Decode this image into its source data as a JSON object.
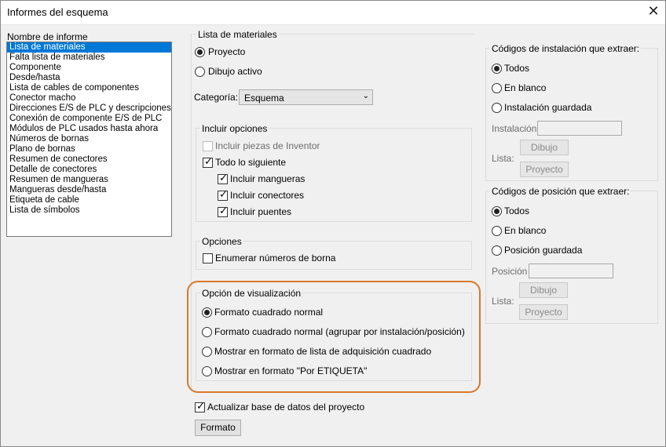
{
  "window": {
    "title": "Informes del esquema",
    "close_icon": "close-icon"
  },
  "report_list": {
    "label": "Nombre de informe",
    "items": [
      "Lista de materiales",
      "Falta lista de materiales",
      "Componente",
      "Desde/hasta",
      "Lista de cables de componentes",
      "Conector macho",
      "Direcciones E/S de PLC y descripciones",
      "Conexión de componente E/S de PLC",
      "Módulos de PLC usados hasta ahora",
      "Números de bornas",
      "Plano de bornas",
      "Resumen de conectores",
      "Detalle de conectores",
      "Resumen de mangueras",
      "Mangueras desde/hasta",
      "Etiqueta de cable",
      "Lista de símbolos"
    ],
    "selected_index": 0
  },
  "bom": {
    "title": "Lista de materiales",
    "scope_project": "Proyecto",
    "scope_drawing": "Dibujo activo",
    "category_label": "Categoría:",
    "category_value": "Esquema"
  },
  "include": {
    "title": "Incluir opciones",
    "inventor": "Incluir piezas de Inventor",
    "all_following": "Todo lo siguiente",
    "hoses": "Incluir mangueras",
    "connectors": "Incluir conectores",
    "jumpers": "Incluir puentes"
  },
  "options": {
    "title": "Opciones",
    "enumerate": "Enumerar números de borna"
  },
  "display": {
    "title": "Opción de visualización",
    "opt1": "Formato cuadrado normal",
    "opt2": "Formato cuadrado normal (agrupar por instalación/posición)",
    "opt3": "Mostrar en formato de lista de adquisición cuadrado",
    "opt4": "Mostrar en formato \"Por ETIQUETA\""
  },
  "update_db": "Actualizar base de datos del proyecto",
  "format_button": "Formato",
  "install_codes": {
    "title": "Códigos de instalación que extraer:",
    "all": "Todos",
    "blank": "En blanco",
    "saved": "Instalación guardada",
    "field_label": "Instalación",
    "list_label": "Lista:",
    "drawing_button": "Dibujo",
    "project_button": "Proyecto"
  },
  "location_codes": {
    "title": "Códigos de posición que extraer:",
    "all": "Todos",
    "blank": "En blanco",
    "saved": "Posición guardada",
    "field_label": "Posición",
    "list_label": "Lista:",
    "drawing_button": "Dibujo",
    "project_button": "Proyecto"
  },
  "colors": {
    "selection": "#0078d7",
    "highlight": "#d9782a"
  }
}
